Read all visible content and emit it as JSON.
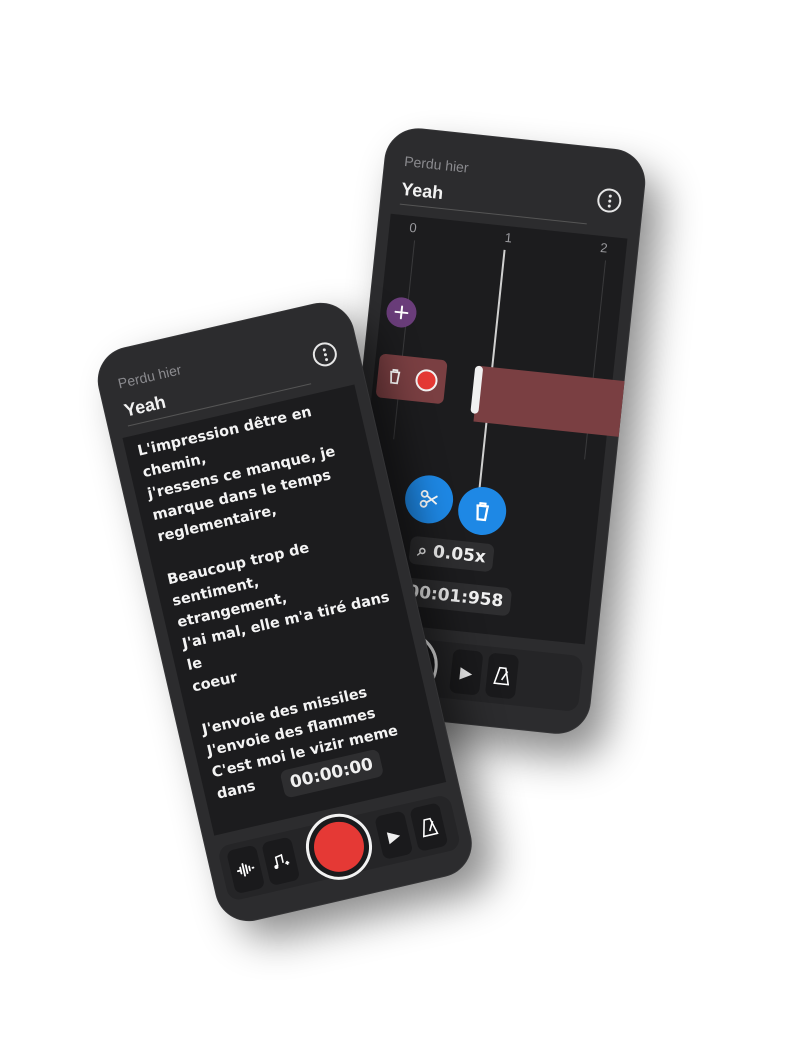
{
  "back_phone": {
    "subtitle": "Perdu hier",
    "title": "Yeah",
    "timeline": {
      "ticks": [
        "0",
        "1",
        "2"
      ]
    },
    "zoom_label": "0.05x",
    "time": "00:01:958"
  },
  "front_phone": {
    "subtitle": "Perdu hier",
    "title": "Yeah",
    "lyrics": [
      "L'impression dêtre en chemin,\nj'ressens ce manque, je\nmarque dans le temps\nreglementaire,",
      "Beaucoup trop de sentiment,\netrangement,\nJ'ai mal, elle m'a tiré dans le\ncoeur",
      "J'envoie des missiles\nJ'envoie des flammes\nC'est moi le vizir meme dans"
    ],
    "time": "00:00:00"
  },
  "colors": {
    "record": "#e53935",
    "accent_blue": "#1e88e5",
    "accent_purple": "#6a3d7a",
    "clip": "#7a3f42"
  },
  "icons": {
    "menu": "kebab-menu-icon",
    "add": "plus-icon",
    "delete": "trash-icon",
    "split": "scissors-icon",
    "zoom": "search-icon",
    "play": "play-icon",
    "metronome": "metronome-icon",
    "waveform": "waveform-icon",
    "add_music": "music-add-icon"
  }
}
